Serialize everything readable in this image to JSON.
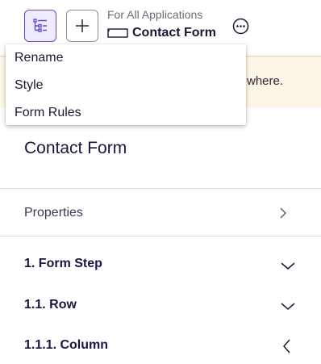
{
  "header": {
    "context_label": "For All Applications",
    "form_title": "Contact Form",
    "icons": {
      "structure": "list-tree-icon",
      "add": "plus-icon",
      "form": "form-outline-icon",
      "more": "ellipsis-circle-icon"
    }
  },
  "banner": {
    "text_fragment": "where."
  },
  "menu": {
    "items": [
      {
        "label": "Rename"
      },
      {
        "label": "Style"
      },
      {
        "label": "Form Rules"
      }
    ]
  },
  "main": {
    "title": "Contact Form",
    "properties_label": "Properties",
    "tree": [
      {
        "label": "1. Form Step",
        "state": "expanded"
      },
      {
        "label": "1.1. Row",
        "state": "expanded"
      },
      {
        "label": "1.1.1. Column",
        "state": "collapsed"
      }
    ]
  },
  "colors": {
    "accent": "#5b49e0",
    "banner_bg": "#fdf6e6",
    "banner_border": "#ecd49a",
    "text_dark": "#1a1640"
  }
}
